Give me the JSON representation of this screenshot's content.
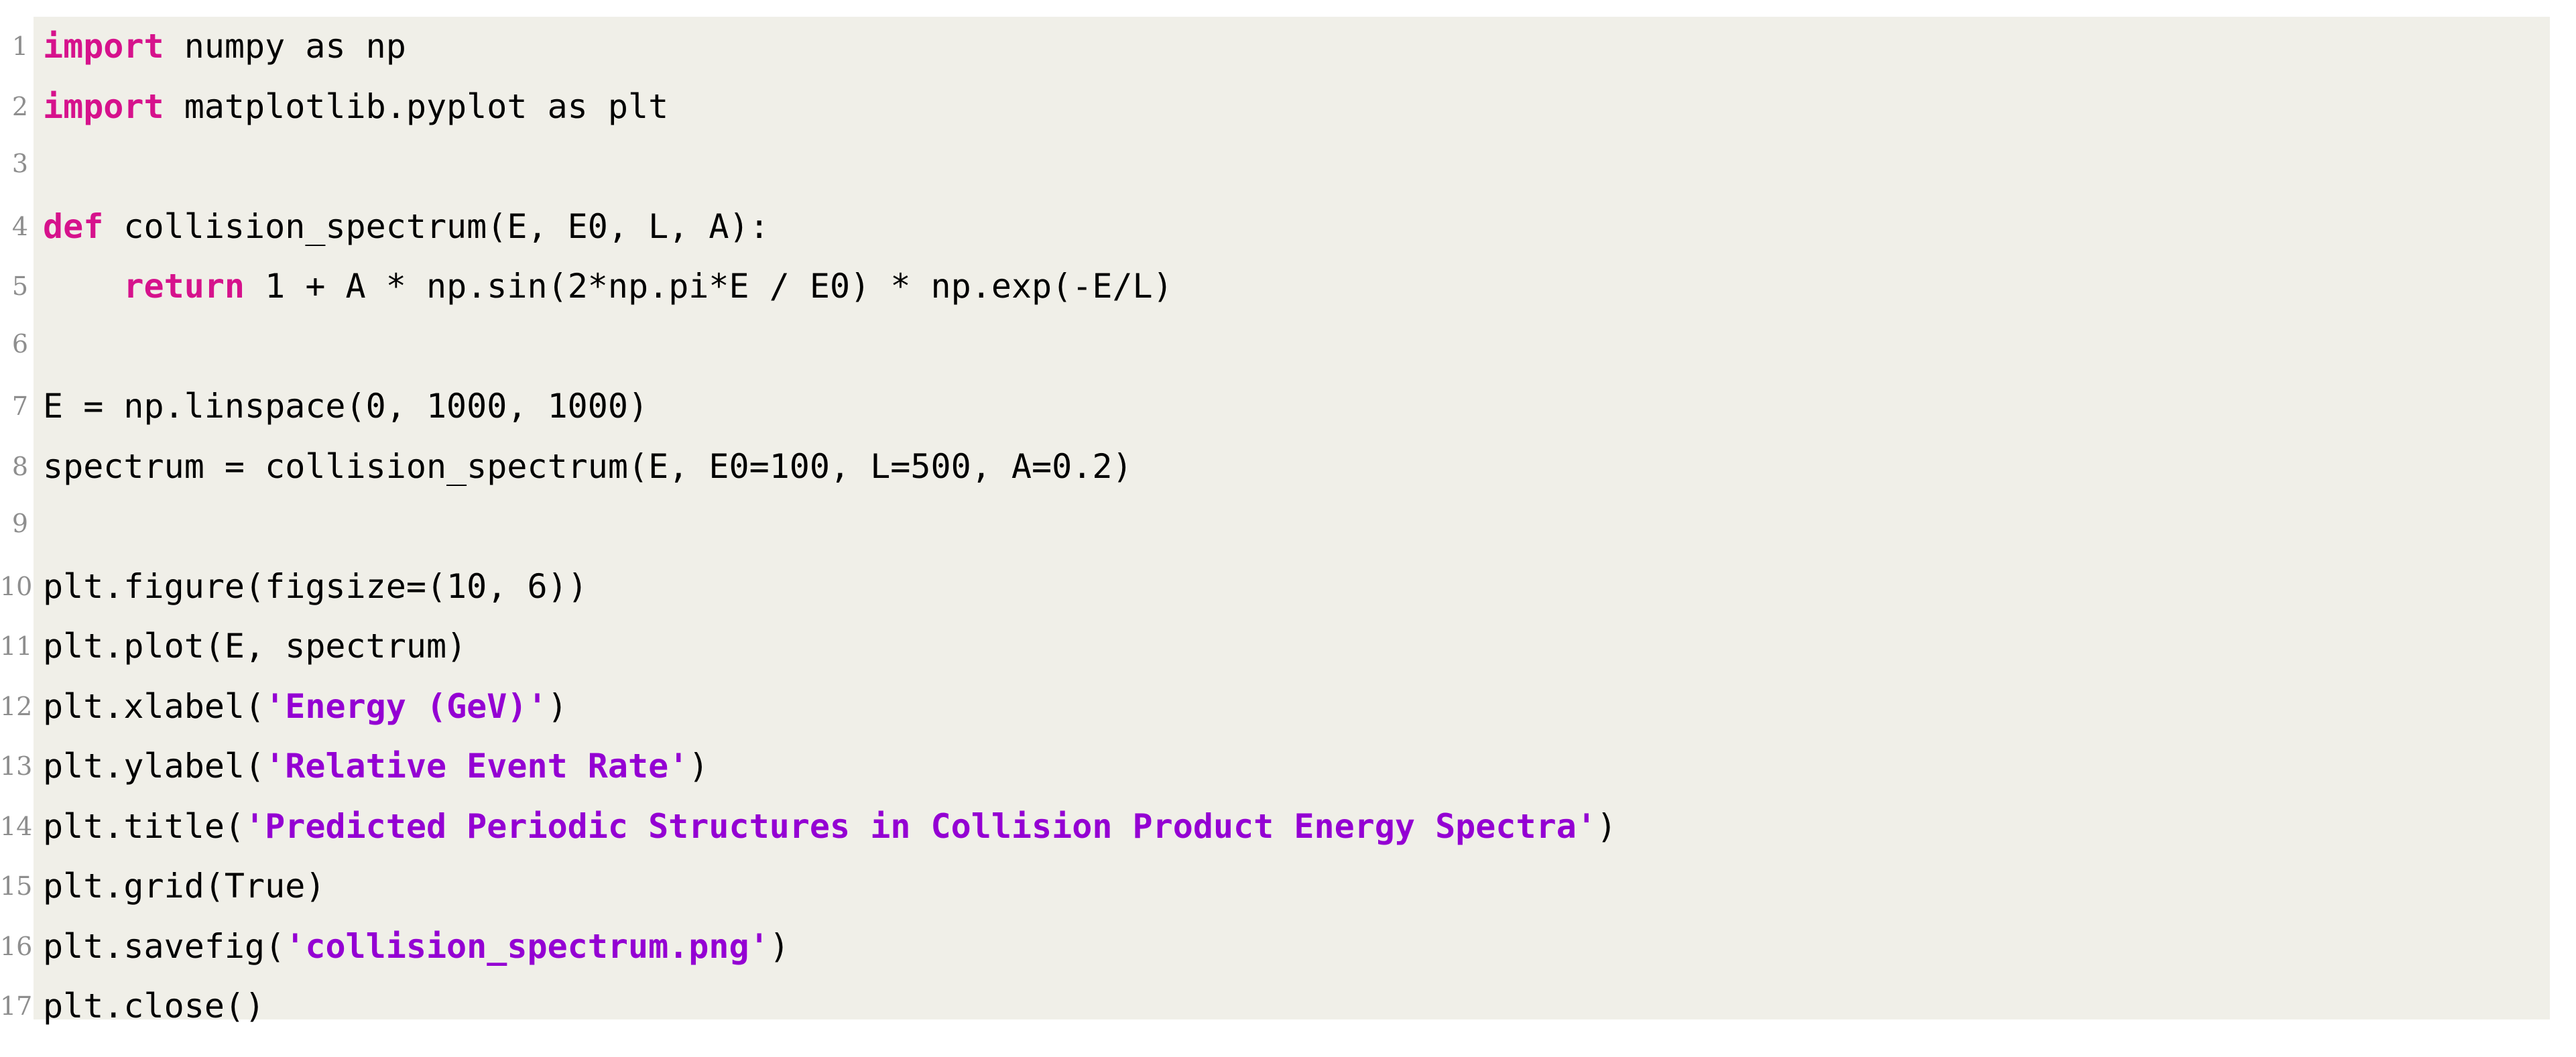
{
  "document": {
    "type": "code-listing",
    "language": "python",
    "background_color": "#f0efe8",
    "page_color": "#ffffff",
    "keyword_color": "#d6128c",
    "string_color": "#9400d3",
    "text_color": "#000000",
    "lineno_color": "#8e8e8e",
    "total_lines": 17
  },
  "lines": [
    {
      "number": "1",
      "text": "import numpy as np",
      "tokens": [
        {
          "t": "import",
          "c": "kw"
        },
        {
          "t": " numpy as np",
          "c": "pl"
        }
      ]
    },
    {
      "number": "2",
      "text": "import matplotlib.pyplot as plt",
      "tokens": [
        {
          "t": "import",
          "c": "kw"
        },
        {
          "t": " matplotlib.pyplot as plt",
          "c": "pl"
        }
      ]
    },
    {
      "number": "3",
      "text": "",
      "tokens": []
    },
    {
      "number": "4",
      "text": "def collision_spectrum(E, E0, L, A):",
      "tokens": [
        {
          "t": "def",
          "c": "kw"
        },
        {
          "t": " collision_spectrum(E, E0, L, A):",
          "c": "pl"
        }
      ]
    },
    {
      "number": "5",
      "text": "    return 1 + A * np.sin(2*np.pi*E / E0) * np.exp(-E/L)",
      "tokens": [
        {
          "t": "    ",
          "c": "pl"
        },
        {
          "t": "return",
          "c": "kw"
        },
        {
          "t": " 1 + A * np.sin(2*np.pi*E / E0) * np.exp(-E/L)",
          "c": "pl"
        }
      ]
    },
    {
      "number": "6",
      "text": "",
      "tokens": []
    },
    {
      "number": "7",
      "text": "E = np.linspace(0, 1000, 1000)",
      "tokens": [
        {
          "t": "E = np.linspace(0, 1000, 1000)",
          "c": "pl"
        }
      ]
    },
    {
      "number": "8",
      "text": "spectrum = collision_spectrum(E, E0=100, L=500, A=0.2)",
      "tokens": [
        {
          "t": "spectrum = collision_spectrum(E, E0=100, L=500, A=0.2)",
          "c": "pl"
        }
      ]
    },
    {
      "number": "9",
      "text": "",
      "tokens": []
    },
    {
      "number": "10",
      "text": "plt.figure(figsize=(10, 6))",
      "tokens": [
        {
          "t": "plt.figure(figsize=(10, 6))",
          "c": "pl"
        }
      ]
    },
    {
      "number": "11",
      "text": "plt.plot(E, spectrum)",
      "tokens": [
        {
          "t": "plt.plot(E, spectrum)",
          "c": "pl"
        }
      ]
    },
    {
      "number": "12",
      "text": "plt.xlabel('Energy (GeV)')",
      "tokens": [
        {
          "t": "plt.xlabel(",
          "c": "pl"
        },
        {
          "t": "'Energy (GeV)'",
          "c": "str"
        },
        {
          "t": ")",
          "c": "pl"
        }
      ]
    },
    {
      "number": "13",
      "text": "plt.ylabel('Relative Event Rate')",
      "tokens": [
        {
          "t": "plt.ylabel(",
          "c": "pl"
        },
        {
          "t": "'Relative Event Rate'",
          "c": "str"
        },
        {
          "t": ")",
          "c": "pl"
        }
      ]
    },
    {
      "number": "14",
      "text": "plt.title('Predicted Periodic Structures in Collision Product Energy Spectra')",
      "tokens": [
        {
          "t": "plt.title(",
          "c": "pl"
        },
        {
          "t": "'Predicted Periodic Structures in Collision Product Energy Spectra'",
          "c": "str"
        },
        {
          "t": ")",
          "c": "pl"
        }
      ]
    },
    {
      "number": "15",
      "text": "plt.grid(True)",
      "tokens": [
        {
          "t": "plt.grid(True)",
          "c": "pl"
        }
      ]
    },
    {
      "number": "16",
      "text": "plt.savefig('collision_spectrum.png')",
      "tokens": [
        {
          "t": "plt.savefig(",
          "c": "pl"
        },
        {
          "t": "'collision_spectrum.png'",
          "c": "str"
        },
        {
          "t": ")",
          "c": "pl"
        }
      ]
    },
    {
      "number": "17",
      "text": "plt.close()",
      "tokens": [
        {
          "t": "plt.close()",
          "c": "pl"
        }
      ]
    }
  ]
}
